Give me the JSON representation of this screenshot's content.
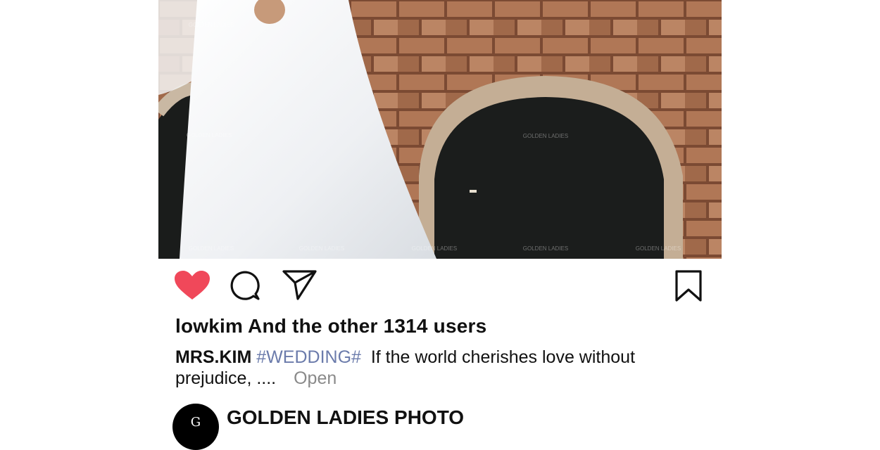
{
  "post": {
    "photo_alt": "Bride in white gown before stone arch",
    "watermark": {
      "brand": "GOLDEN LADIES",
      "sub": "成都金夫人"
    },
    "actions": {
      "like_icon": "heart-icon",
      "comment_icon": "comment-icon",
      "share_icon": "send-icon",
      "save_icon": "bookmark-icon",
      "like_color": "#f0485a"
    },
    "likes_text": "lowkim And the other 1314 users",
    "caption": {
      "user": "MRS.KIM",
      "tag": "#WEDDING#",
      "text": "If the world cherishes love without prejudice, ....",
      "open_label": "Open"
    },
    "profile": {
      "avatar_glyph": "G",
      "name": "GOLDEN LADIES PHOTO"
    }
  }
}
